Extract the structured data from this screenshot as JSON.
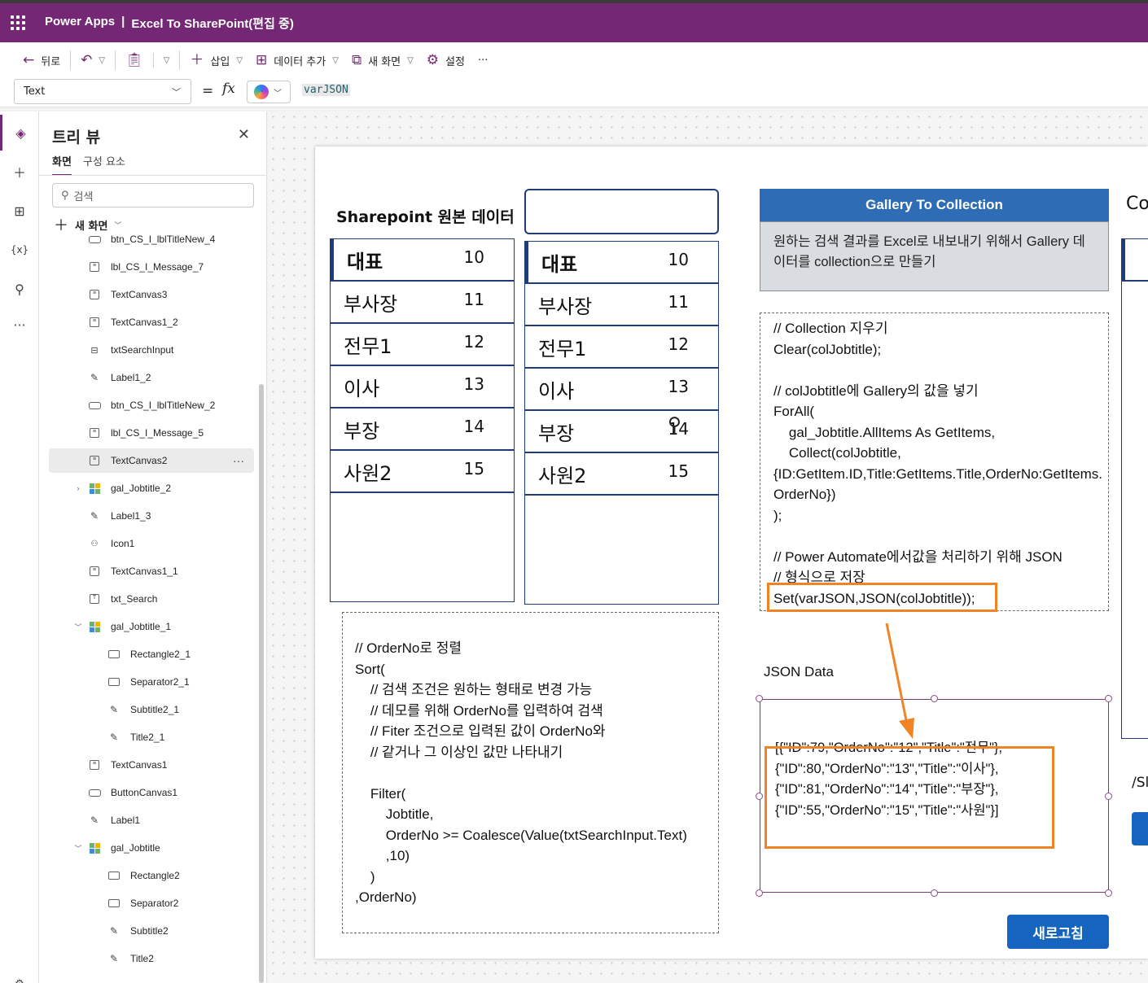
{
  "app": {
    "name": "Power Apps",
    "separator": "|",
    "doc_title": "Excel To SharePoint(편집 중)"
  },
  "toolbar": {
    "back": "뒤로",
    "insert": "삽입",
    "add_data": "데이터 추가",
    "new_screen": "새 화면",
    "settings": "설정",
    "more": "···"
  },
  "formula_bar": {
    "property": "Text",
    "equals": "=",
    "fx": "fx",
    "formula": "varJSON"
  },
  "tree": {
    "title": "트리 뷰",
    "tabs": [
      "화면",
      "구성 요소"
    ],
    "search_placeholder": "검색",
    "new_screen": "새 화면",
    "items": [
      {
        "label": "btn_CS_I_lblTitleNew_4",
        "icon": "button-icon",
        "indent": 0
      },
      {
        "label": "lbl_CS_I_Message_7",
        "icon": "text-icon",
        "indent": 0
      },
      {
        "label": "TextCanvas3",
        "icon": "text-icon",
        "indent": 0
      },
      {
        "label": "TextCanvas1_2",
        "icon": "text-icon",
        "indent": 0
      },
      {
        "label": "txtSearchInput",
        "icon": "input-icon",
        "indent": 0
      },
      {
        "label": "Label1_2",
        "icon": "label-icon",
        "indent": 0
      },
      {
        "label": "btn_CS_I_lblTitleNew_2",
        "icon": "button-icon",
        "indent": 0
      },
      {
        "label": "lbl_CS_I_Message_5",
        "icon": "text-icon",
        "indent": 0
      },
      {
        "label": "TextCanvas2",
        "icon": "text-icon",
        "indent": 0,
        "selected": true
      },
      {
        "label": "gal_Jobtitle_2",
        "icon": "gallery-icon",
        "indent": 0,
        "expander": "collapsed"
      },
      {
        "label": "Label1_3",
        "icon": "label-icon",
        "indent": 0
      },
      {
        "label": "Icon1",
        "icon": "icons-icon",
        "indent": 0
      },
      {
        "label": "TextCanvas1_1",
        "icon": "text-icon",
        "indent": 0
      },
      {
        "label": "txt_Search",
        "icon": "textinput-icon",
        "indent": 0
      },
      {
        "label": "gal_Jobtitle_1",
        "icon": "gallery-icon",
        "indent": 0,
        "expander": "expanded"
      },
      {
        "label": "Rectangle2_1",
        "icon": "rectangle-icon",
        "indent": 1
      },
      {
        "label": "Separator2_1",
        "icon": "rectangle-icon",
        "indent": 1
      },
      {
        "label": "Subtitle2_1",
        "icon": "label-icon",
        "indent": 1
      },
      {
        "label": "Title2_1",
        "icon": "label-icon",
        "indent": 1
      },
      {
        "label": "TextCanvas1",
        "icon": "text-icon",
        "indent": 0
      },
      {
        "label": "ButtonCanvas1",
        "icon": "button-icon",
        "indent": 0
      },
      {
        "label": "Label1",
        "icon": "label-icon",
        "indent": 0
      },
      {
        "label": "gal_Jobtitle",
        "icon": "gallery-icon",
        "indent": 0,
        "expander": "expanded"
      },
      {
        "label": "Rectangle2",
        "icon": "rectangle-icon",
        "indent": 1
      },
      {
        "label": "Separator2",
        "icon": "rectangle-icon",
        "indent": 1
      },
      {
        "label": "Subtitle2",
        "icon": "label-icon",
        "indent": 1
      },
      {
        "label": "Title2",
        "icon": "label-icon",
        "indent": 1
      }
    ]
  },
  "canvas": {
    "source_title": "Sharepoint 원본 데이터",
    "gallery_left": [
      {
        "title": "대표",
        "no": "10"
      },
      {
        "title": "부사장",
        "no": "11"
      },
      {
        "title": "전무1",
        "no": "12"
      },
      {
        "title": "이사",
        "no": "13"
      },
      {
        "title": "부장",
        "no": "14"
      },
      {
        "title": "사원2",
        "no": "15"
      }
    ],
    "gallery_right": [
      {
        "title": "대표",
        "no": "10"
      },
      {
        "title": "부사장",
        "no": "11"
      },
      {
        "title": "전무1",
        "no": "12"
      },
      {
        "title": "이사",
        "no": "13"
      },
      {
        "title": "부장",
        "no": "14"
      },
      {
        "title": "사원2",
        "no": "15"
      }
    ],
    "sort_code": "// OrderNo로 정렬\nSort(\n    // 검색 조건은 원하는 형태로 변경 가능\n    // 데모를 위해 OrderNo를 입력하여 검색\n    // Fiter 조건으로 입력된 값이 OrderNo와\n    // 같거나 그 이상인 값만 나타내기\n\n    Filter(\n        Jobtitle,\n        OrderNo >= Coalesce(Value(txtSearchInput.Text)\n        ,10)\n    )\n,OrderNo)",
    "gallery_header": "Gallery To Collection",
    "gallery_desc": "원하는 검색 결과를 Excel로 내보내기 위해서 Gallery 데이터를 collection으로 만들기",
    "collection_code": "// Collection 지우기\nClear(colJobtitle);\n\n// colJobtitle에 Gallery의 값을 넣기\nForAll(\n    gal_Jobtitle.AllItems As GetItems,\n    Collect(colJobtitle,\n{ID:GetItem.ID,Title:GetItems.Title,OrderNo:GetItems.\nOrderNo})\n);\n\n// Power Automate에서값을 처리하기 위해 JSON\n// 형식으로 저장\nSet(varJSON,JSON(colJobtitle));",
    "json_label": "JSON Data",
    "json_text": "[{\"ID\":79,\"OrderNo\":\"12\",\"Title\":\"전무\"},\n{\"ID\":80,\"OrderNo\":\"13\",\"Title\":\"이사\"},\n{\"ID\":81,\"OrderNo\":\"14\",\"Title\":\"부장\"},\n{\"ID\":55,\"OrderNo\":\"15\",\"Title\":\"사원\"}]",
    "refresh_button": "새로고침",
    "partial_title": "Co",
    "partial_sl": "/Sl",
    "colors": {
      "accent": "#742774",
      "navy": "#1f3b7a",
      "blue": "#2e6db6",
      "button": "#1565c0",
      "highlight": "#f08424"
    }
  }
}
